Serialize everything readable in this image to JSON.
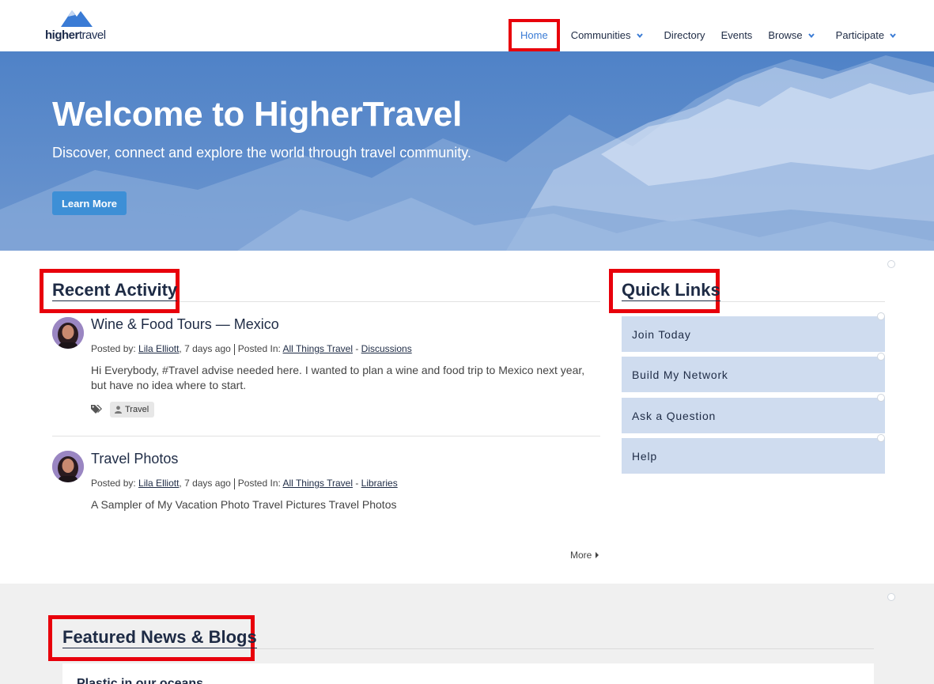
{
  "brand": {
    "logo_text_bold": "higher",
    "logo_text_rest": "travel"
  },
  "nav": [
    {
      "label": "Home",
      "dropdown": false,
      "active": true
    },
    {
      "label": "Communities",
      "dropdown": true
    },
    {
      "label": "Directory",
      "dropdown": false
    },
    {
      "label": "Events",
      "dropdown": false
    },
    {
      "label": "Browse",
      "dropdown": true
    },
    {
      "label": "Participate",
      "dropdown": true
    }
  ],
  "hero": {
    "title": "Welcome to HigherTravel",
    "subtitle": "Discover, connect and explore the world through travel community.",
    "button": "Learn More"
  },
  "activity": {
    "title": "Recent Activity",
    "items": [
      {
        "title": "Wine & Food Tours — Mexico",
        "posted_by_label": "Posted by:",
        "author": "Lila Elliott",
        "time": ", 7 days ago",
        "posted_in_label": "Posted In:",
        "community": "All Things Travel",
        "dash": " - ",
        "section": "Discussions",
        "body": "Hi Everybody, #Travel advise needed here. I wanted to plan a wine and food trip to Mexico next year, but have no idea where to start.",
        "tag": "Travel"
      },
      {
        "title": "Travel Photos",
        "posted_by_label": "Posted by:",
        "author": "Lila Elliott",
        "time": ", 7 days ago",
        "posted_in_label": "Posted In:",
        "community": "All Things Travel",
        "dash": " - ",
        "section": "Libraries",
        "body": "A Sampler of My Vacation Photo Travel Pictures Travel Photos"
      }
    ],
    "more": "More"
  },
  "quick_links": {
    "title": "Quick Links",
    "items": [
      "Join Today",
      "Build My Network",
      "Ask a Question",
      "Help"
    ]
  },
  "featured": {
    "title": "Featured News & Blogs",
    "first_card_title": "Plastic in our oceans"
  },
  "colors": {
    "navy": "#1e2b45",
    "accent_blue": "#3a7bd5",
    "highlight_red": "#e8000b",
    "quick_link_bg": "#cfdcef"
  }
}
